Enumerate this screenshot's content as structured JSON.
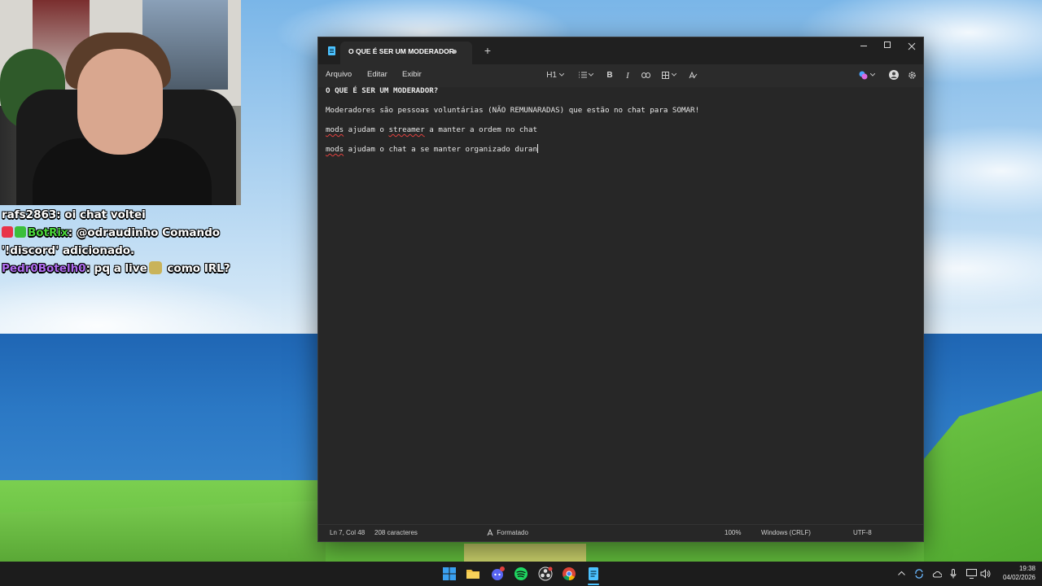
{
  "notepad": {
    "tab_title": "O QUE É SER UM MODERADOR",
    "new_tab_symbol": "+",
    "menus": [
      "Arquivo",
      "Editar",
      "Exibir"
    ],
    "heading_level": "H1",
    "bold_label": "B",
    "italic_label": "I",
    "lines": [
      "O QUE É SER UM MODERADOR?",
      "Moderadores são pessoas voluntárias (NÃO REMUNARADAS) que estão no chat para SOMAR!",
      "mods ajudam o streamer a manter a ordem no chat",
      "mods ajudam o chat a se manter organizado duran"
    ],
    "status": {
      "position": "Ln 7, Col 48",
      "chars": "208 caracteres",
      "format": "Formatado",
      "zoom": "100%",
      "line_ending": "Windows (CRLF)",
      "encoding": "UTF-8"
    },
    "colors": {
      "accent": "#4cc2ff",
      "spellcheck": "#e0413f",
      "background": "#272727"
    }
  },
  "chat": [
    {
      "user": "rafs2863",
      "user_color": "#ffffff",
      "message": " oi chat voltei"
    },
    {
      "user": "BotRix",
      "user_color": "#4ad63a",
      "message": " @odraudinho Comando"
    },
    {
      "user": "",
      "user_color": "#ffffff",
      "message": "'!discord' adicionado."
    },
    {
      "user": "Pedr0Botelh0",
      "user_color": "#b06cf0",
      "message_before": " pq a live",
      "message_after": " como IRL?"
    }
  ],
  "taskbar": {
    "time": "19:38",
    "date": "04/02/2026",
    "icons": [
      "windows-start-icon",
      "file-explorer-icon",
      "discord-icon",
      "spotify-icon",
      "obs-icon",
      "chrome-icon",
      "notepad-icon"
    ],
    "tray_icons": [
      "chevron-up-icon",
      "sync-icon",
      "cloud-icon",
      "microphone-icon",
      "display-icon",
      "speaker-icon"
    ]
  }
}
